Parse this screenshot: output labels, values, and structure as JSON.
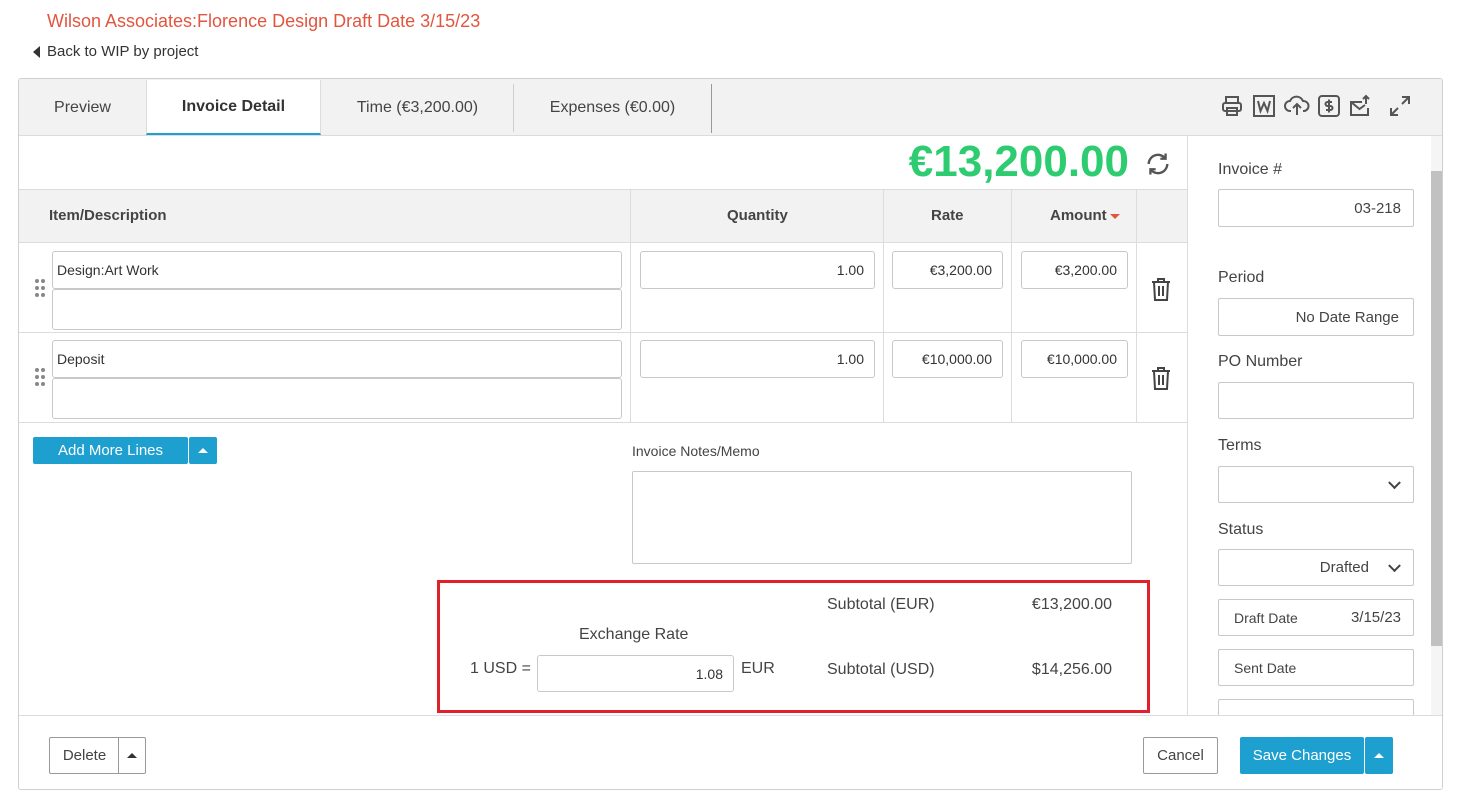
{
  "header": {
    "title": "Wilson Associates:Florence Design Draft Date 3/15/23",
    "back_label": "Back to WIP by project"
  },
  "tabs": [
    {
      "label": "Preview",
      "active": false
    },
    {
      "label": "Invoice Detail",
      "active": true
    },
    {
      "label": "Time (€3,200.00)",
      "active": false
    },
    {
      "label": "Expenses (€0.00)",
      "active": false
    }
  ],
  "toolbar_icons": [
    "print-icon",
    "word-icon",
    "upload-icon",
    "dollar-icon",
    "email-export-icon",
    "expand-icon"
  ],
  "invoice_total": "€13,200.00",
  "table": {
    "headers": {
      "item": "Item/Description",
      "quantity": "Quantity",
      "rate": "Rate",
      "amount": "Amount"
    },
    "rows": [
      {
        "item": "Design:Art Work",
        "description": "",
        "quantity": "1.00",
        "rate": "€3,200.00",
        "amount": "€3,200.00"
      },
      {
        "item": "Deposit",
        "description": "",
        "quantity": "1.00",
        "rate": "€10,000.00",
        "amount": "€10,000.00"
      }
    ]
  },
  "add_lines_label": "Add More Lines",
  "notes_label": "Invoice Notes/Memo",
  "notes_value": "",
  "exchange": {
    "title": "Exchange Rate",
    "prefix": "1 USD =",
    "value": "1.08",
    "suffix": "EUR",
    "subtotal_eur_label": "Subtotal (EUR)",
    "subtotal_eur_value": "€13,200.00",
    "subtotal_usd_label": "Subtotal (USD)",
    "subtotal_usd_value": "$14,256.00"
  },
  "sidebar": {
    "invoice_num_label": "Invoice #",
    "invoice_num_value": "03-218",
    "period_label": "Period",
    "period_value": "No Date Range",
    "po_label": "PO Number",
    "po_value": "",
    "terms_label": "Terms",
    "terms_value": "",
    "status_label": "Status",
    "status_value": "Drafted",
    "draft_date_label": "Draft Date",
    "draft_date_value": "3/15/23",
    "sent_date_label": "Sent Date",
    "sent_date_value": ""
  },
  "footer": {
    "delete_label": "Delete",
    "cancel_label": "Cancel",
    "save_label": "Save Changes"
  },
  "colors": {
    "accent": "#1d9fd0",
    "title": "#e2553e",
    "total": "#2ecc71",
    "highlight_box": "#e0202a"
  }
}
